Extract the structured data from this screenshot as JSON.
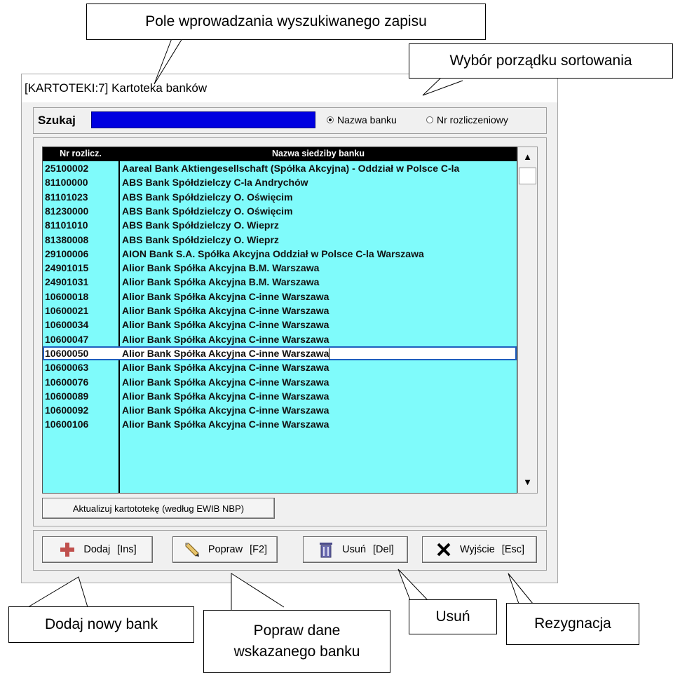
{
  "window": {
    "title": "[KARTOTEKI:7]  Kartoteka banków"
  },
  "search": {
    "label": "Szukaj",
    "value": "",
    "sort_options": [
      {
        "label": "Nazwa banku",
        "selected": true
      },
      {
        "label": "Nr rozliczeniowy",
        "selected": false
      }
    ]
  },
  "table": {
    "columns": [
      "Nr rozlicz.",
      "Nazwa siedziby banku"
    ],
    "selected_index": 13,
    "rows": [
      [
        "25100002",
        "Aareal Bank Aktiengesellschaft (Spółka Akcyjna) - Oddział w Polsce C-la"
      ],
      [
        "81100000",
        "ABS Bank Spółdzielczy C-la Andrychów"
      ],
      [
        "81101023",
        "ABS Bank Spółdzielczy O. Oświęcim"
      ],
      [
        "81230000",
        "ABS Bank Spółdzielczy O. Oświęcim"
      ],
      [
        "81101010",
        "ABS Bank Spółdzielczy O. Wieprz"
      ],
      [
        "81380008",
        "ABS Bank Spółdzielczy O. Wieprz"
      ],
      [
        "29100006",
        "AION Bank S.A. Spółka Akcyjna Oddział w Polsce C-la Warszawa"
      ],
      [
        "24901015",
        "Alior Bank Spółka Akcyjna B.M. Warszawa"
      ],
      [
        "24901031",
        "Alior Bank Spółka Akcyjna B.M. Warszawa"
      ],
      [
        "10600018",
        "Alior Bank Spółka Akcyjna C-inne Warszawa"
      ],
      [
        "10600021",
        "Alior Bank Spółka Akcyjna C-inne Warszawa"
      ],
      [
        "10600034",
        "Alior Bank Spółka Akcyjna C-inne Warszawa"
      ],
      [
        "10600047",
        "Alior Bank Spółka Akcyjna C-inne Warszawa"
      ],
      [
        "10600050",
        "Alior Bank Spółka Akcyjna C-inne Warszawa"
      ],
      [
        "10600063",
        "Alior Bank Spółka Akcyjna C-inne Warszawa"
      ],
      [
        "10600076",
        "Alior Bank Spółka Akcyjna C-inne Warszawa"
      ],
      [
        "10600089",
        "Alior Bank Spółka Akcyjna C-inne Warszawa"
      ],
      [
        "10600092",
        "Alior Bank Spółka Akcyjna C-inne Warszawa"
      ],
      [
        "10600106",
        "Alior Bank Spółka Akcyjna C-inne Warszawa"
      ]
    ]
  },
  "update_button": "Aktualizuj kartototekę (według EWIB NBP)",
  "buttons": {
    "add": {
      "label": "Dodaj",
      "key": "[Ins]",
      "icon": "plus-icon"
    },
    "edit": {
      "label": "Popraw",
      "key": "[F2]",
      "icon": "pencil-icon"
    },
    "delete": {
      "label": "Usuń",
      "key": "[Del]",
      "icon": "trash-icon"
    },
    "exit": {
      "label": "Wyjście",
      "key": "[Esc]",
      "icon": "close-icon"
    }
  },
  "callouts": {
    "search_field": "Pole wprowadzania wyszukiwanego zapisu",
    "sort_order": "Wybór porządku sortowania",
    "add": "Dodaj nowy bank",
    "edit_line1": "Popraw dane",
    "edit_line2": "wskazanego banku",
    "delete": "Usuń",
    "exit": "Rezygnacja"
  },
  "colors": {
    "grid_bg": "#7ffbfb",
    "search_bg": "#0000e0",
    "header_bg": "#000000",
    "selection_border": "#1f5fbf",
    "add_icon": "#c0504d"
  }
}
